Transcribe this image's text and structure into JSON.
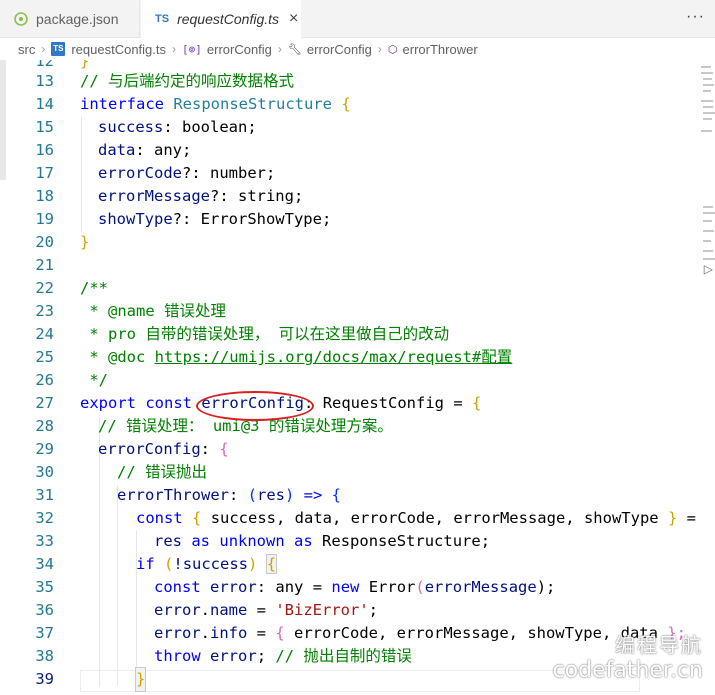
{
  "tabs": [
    {
      "label": "package.json",
      "icon": "json-file-icon",
      "active": false
    },
    {
      "label": "requestConfig.ts",
      "icon": "typescript-file-icon",
      "active": true,
      "close": "×"
    }
  ],
  "more_actions": "···",
  "breadcrumb": {
    "items": [
      "src",
      "requestConfig.ts",
      "errorConfig",
      "errorConfig",
      "errorThrower"
    ],
    "separator": "›",
    "ts_badge": "TS"
  },
  "editor": {
    "line_numbers": [
      "12",
      "13",
      "14",
      "15",
      "16",
      "17",
      "18",
      "19",
      "20",
      "21",
      "22",
      "23",
      "24",
      "25",
      "26",
      "27",
      "28",
      "29",
      "30",
      "31",
      "32",
      "33",
      "34",
      "35",
      "36",
      "37",
      "38",
      "39"
    ],
    "lines": {
      "l12": "}",
      "l13": "// 与后端约定的响应数据格式",
      "l14": [
        "interface",
        " ResponseStructure ",
        "{"
      ],
      "l15": [
        "success",
        ": ",
        "boolean",
        ";"
      ],
      "l16": [
        "data",
        ": ",
        "any",
        ";"
      ],
      "l17": [
        "errorCode",
        "?: ",
        "number",
        ";"
      ],
      "l18": [
        "errorMessage",
        "?: ",
        "string",
        ";"
      ],
      "l19": [
        "showType",
        "?: ",
        "ErrorShowType",
        ";"
      ],
      "l20": "}",
      "l22": "/**",
      "l23": [
        " * @name ",
        "错误处理"
      ],
      "l24": " * pro 自带的错误处理， 可以在这里做自己的改动",
      "l25": [
        " * @doc ",
        "https://umijs.org/docs/max/request#配置"
      ],
      "l26": " */",
      "l27": [
        "export",
        " ",
        "const",
        " ",
        "errorConfig",
        ": ",
        "RequestConfig",
        " = ",
        "{"
      ],
      "l28": "// 错误处理： umi@3 的错误处理方案。",
      "l29": [
        "errorConfig",
        ": ",
        "{"
      ],
      "l30": "// 错误抛出",
      "l31": [
        "errorThrower",
        ": ",
        "(",
        "res",
        ")",
        " => ",
        "{"
      ],
      "l32": [
        "const",
        " ",
        "{",
        " success, data, errorCode, errorMessage, showType ",
        "}",
        " ="
      ],
      "l33": [
        "res",
        " ",
        "as",
        " ",
        "unknown",
        " ",
        "as",
        " ",
        "ResponseStructure",
        ";"
      ],
      "l34": [
        "if",
        " ",
        "(",
        "!success",
        ")",
        " ",
        "{"
      ],
      "l35": [
        "const",
        " ",
        "error",
        ": ",
        "any",
        " = ",
        "new",
        " ",
        "Error",
        "(",
        "errorMessage",
        ");"
      ],
      "l36": [
        "error",
        ".",
        "name",
        " = ",
        "'BizError'",
        ";"
      ],
      "l37": [
        "error",
        ".",
        "info",
        " = ",
        "{",
        " errorCode, errorMessage, showType, data ",
        "};"
      ],
      "l38": [
        "throw",
        " ",
        "error",
        "; ",
        "// 抛出自制的错误"
      ],
      "l39": "}"
    }
  },
  "watermark": {
    "line1": "编程导航",
    "line2": "codefather.cn"
  },
  "colors": {
    "keyword": "#0000ff",
    "type": "#267f99",
    "comment": "#008000",
    "string": "#a31515",
    "property": "#001080",
    "annotation": "#d82020"
  }
}
